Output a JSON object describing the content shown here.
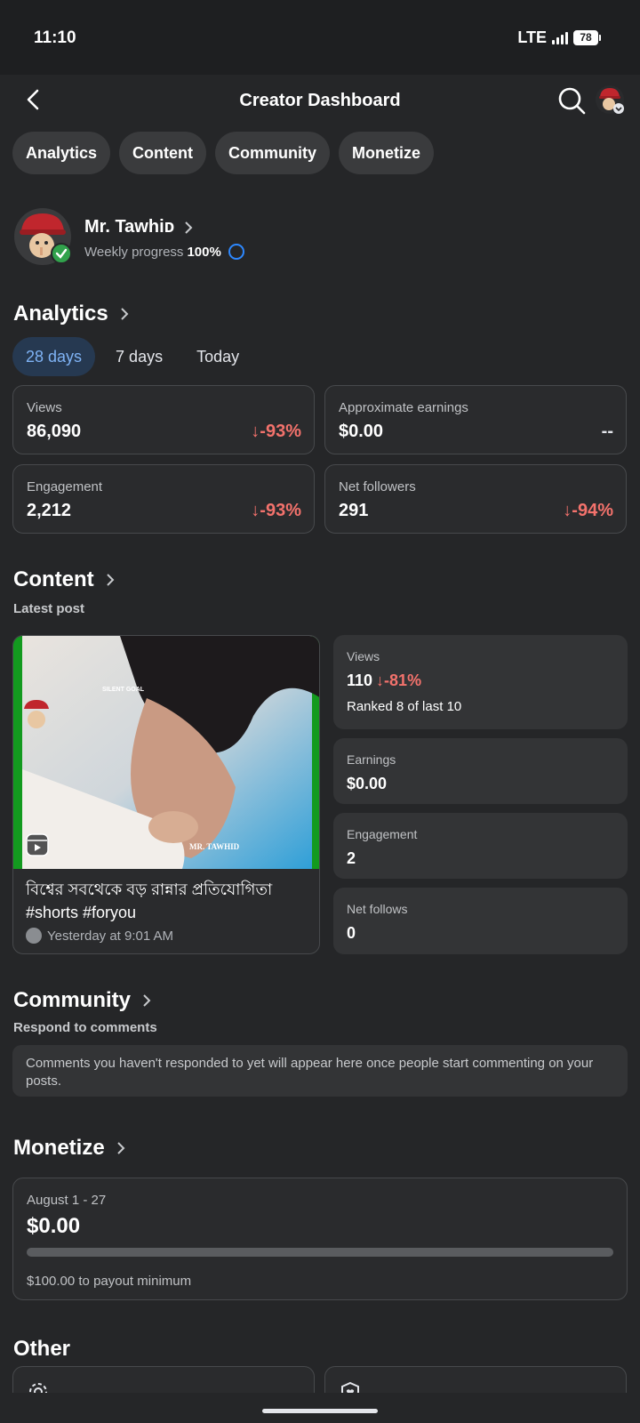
{
  "status_bar": {
    "time": "11:10",
    "network": "LTE",
    "battery": "78"
  },
  "header": {
    "title": "Creator Dashboard"
  },
  "tabs": [
    "Analytics",
    "Content",
    "Community",
    "Monetize"
  ],
  "profile": {
    "name": "Mr. Tawhiᴅ",
    "progress_label": "Weekly progress",
    "progress_value": "100%"
  },
  "analytics": {
    "title": "Analytics",
    "ranges": [
      "28 days",
      "7 days",
      "Today"
    ],
    "active_range": "28 days",
    "stats": [
      {
        "label": "Views",
        "value": "86,090",
        "change": "-93%"
      },
      {
        "label": "Approximate earnings",
        "value": "$0.00",
        "change": "--"
      },
      {
        "label": "Engagement",
        "value": "2,212",
        "change": "-93%"
      },
      {
        "label": "Net followers",
        "value": "291",
        "change": "-94%"
      }
    ]
  },
  "content": {
    "title": "Content",
    "subtitle": "Latest post",
    "post": {
      "overlay_top": "SILENT GOAL",
      "overlay_watermark": "MR. TAWHID",
      "caption": "বিশ্বের সবথেকে বড় রান্নার প্রতিযোগিতা  #shorts #foryou",
      "time": "Yesterday at 9:01 AM"
    },
    "metrics": [
      {
        "label": "Views",
        "value": "110",
        "change": "-81%",
        "extra": "Ranked 8 of last 10"
      },
      {
        "label": "Earnings",
        "value": "$0.00"
      },
      {
        "label": "Engagement",
        "value": "2"
      },
      {
        "label": "Net follows",
        "value": "0"
      }
    ]
  },
  "community": {
    "title": "Community",
    "subtitle": "Respond to comments",
    "notice": "Comments you haven't responded to yet will appear here once people start commenting on your posts."
  },
  "monetize": {
    "title": "Monetize",
    "range": "August 1 - 27",
    "amount": "$0.00",
    "progress": 0,
    "note": "$100.00 to payout minimum"
  },
  "other": {
    "title": "Other"
  },
  "icons": [
    "back-arrow-icon",
    "search-icon",
    "chevron-right-icon",
    "reel-icon",
    "globe-icon",
    "gear-icon",
    "shield-heart-icon"
  ],
  "colors": {
    "background": "#252628",
    "accent": "#2d88ff",
    "negative": "#f3726c",
    "active_range_bg": "#263951"
  }
}
